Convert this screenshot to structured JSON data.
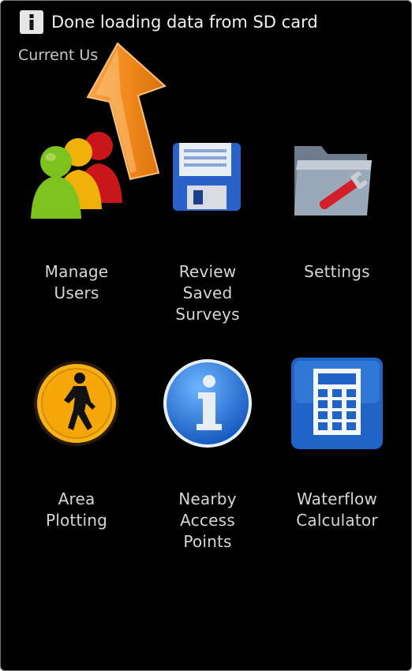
{
  "toast": {
    "text": "Done loading data from SD card",
    "icon": "info-icon"
  },
  "header": {
    "current_user_label": "Current Us"
  },
  "grid": {
    "items": [
      {
        "label": "Manage\nUsers",
        "icon": "users-icon"
      },
      {
        "label": "Review\nSaved\nSurveys",
        "icon": "floppy-disk-icon"
      },
      {
        "label": "Settings",
        "icon": "folder-wrench-icon"
      },
      {
        "label": "Area\nPlotting",
        "icon": "pedestrian-sign-icon"
      },
      {
        "label": "Nearby\nAccess\nPoints",
        "icon": "info-circle-icon"
      },
      {
        "label": "Waterflow\nCalculator",
        "icon": "calculator-icon"
      }
    ]
  },
  "colors": {
    "background": "#000000",
    "arrow": "#f5922a",
    "label": "#d6d6d6"
  }
}
